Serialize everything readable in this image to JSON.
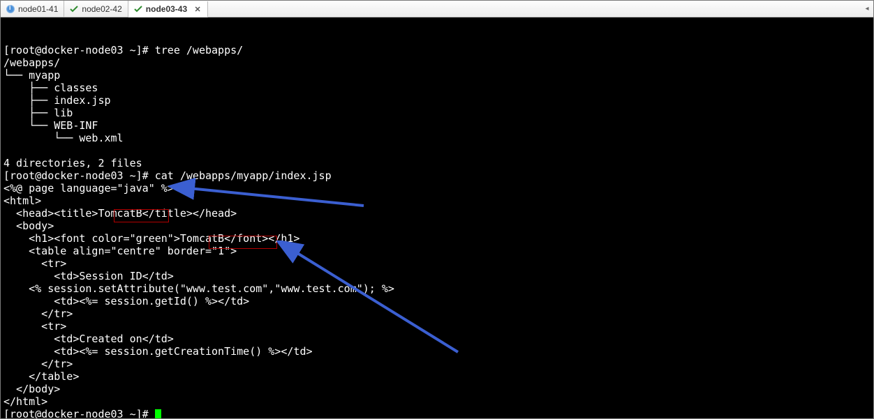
{
  "tabs": [
    {
      "label": "node01-41",
      "icon": "info-blue"
    },
    {
      "label": "node02-42",
      "icon": "check-green"
    },
    {
      "label": "node03-43",
      "icon": "check-green",
      "active": true
    }
  ],
  "terminal": {
    "lines": [
      "[root@docker-node03 ~]# tree /webapps/",
      "/webapps/",
      "└── myapp",
      "    ├── classes",
      "    ├── index.jsp",
      "    ├── lib",
      "    └── WEB-INF",
      "        └── web.xml",
      "",
      "4 directories, 2 files",
      "[root@docker-node03 ~]# cat /webapps/myapp/index.jsp",
      "<%@ page language=\"java\" %>",
      "<html>",
      "  <head><title>TomcatB</title></head>",
      "  <body>",
      "    <h1><font color=\"green\">TomcatB</font></h1>",
      "    <table align=\"centre\" border=\"1\">",
      "      <tr>",
      "        <td>Session ID</td>",
      "    <% session.setAttribute(\"www.test.com\",\"www.test.com\"); %>",
      "        <td><%= session.getId() %></td>",
      "      </tr>",
      "      <tr>",
      "        <td>Created on</td>",
      "        <td><%= session.getCreationTime() %></td>",
      "      </tr>",
      "    </table>",
      "  </body>",
      "</html>",
      "[root@docker-node03 ~]# "
    ]
  },
  "prompt": "[root@docker-node03 ~]# ",
  "highlight1": "TomcatB",
  "highlight2": ">TomcatB<"
}
